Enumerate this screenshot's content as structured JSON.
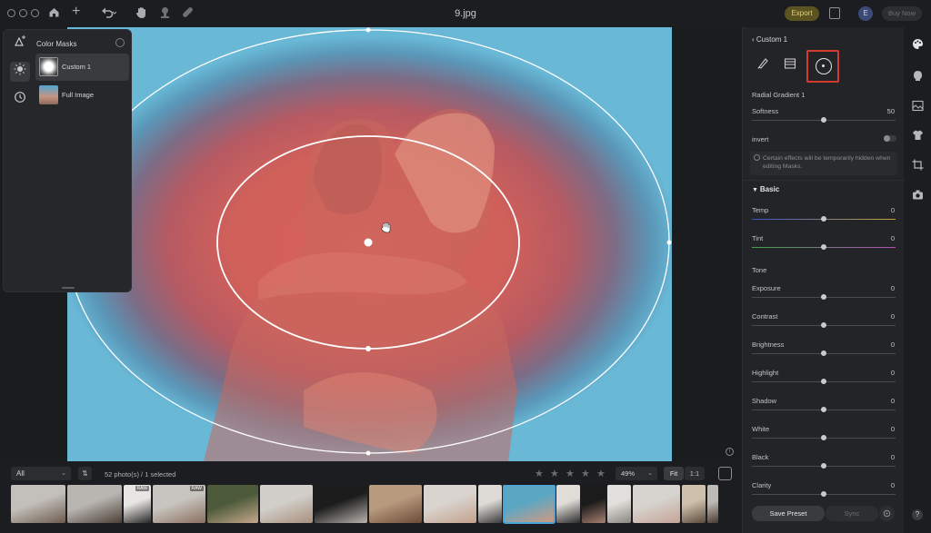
{
  "window": {
    "title": "9.jpg"
  },
  "toolbar": {
    "export_label": "Export",
    "avatar_initial": "E",
    "buy_now_label": "Buy Now"
  },
  "mask_panel": {
    "title": "Color Masks",
    "items": [
      {
        "label": "Custom 1",
        "selected": true
      },
      {
        "label": "Full Image",
        "selected": false
      }
    ]
  },
  "filmstrip_bar": {
    "filter_value": "All",
    "photo_count": "52 photo(s) / 1 selected",
    "rating_stars": 5,
    "zoom_value": "49%",
    "fit_label": "Fit",
    "one_to_one_label": "1:1"
  },
  "filmstrip": {
    "thumbnails": [
      {
        "badge": "",
        "colors": [
          "#c3c0bb",
          "#6d5b4d"
        ]
      },
      {
        "badge": "",
        "colors": [
          "#b9b6b2",
          "#4b3f35"
        ]
      },
      {
        "badge": "RAW",
        "colors": [
          "#e8e6e2",
          "#262626"
        ]
      },
      {
        "badge": "RAW",
        "colors": [
          "#c8c5c0",
          "#8b6f5e"
        ]
      },
      {
        "badge": "",
        "colors": [
          "#4c5a3a",
          "#c7a88c"
        ]
      },
      {
        "badge": "",
        "colors": [
          "#d2cfca",
          "#a88f7c"
        ]
      },
      {
        "badge": "",
        "colors": [
          "#1c1c1c",
          "#b9b3ae"
        ]
      },
      {
        "badge": "",
        "colors": [
          "#b89a7e",
          "#6b4a36"
        ]
      },
      {
        "badge": "",
        "colors": [
          "#d9d4cf",
          "#c3a08a"
        ]
      },
      {
        "badge": "",
        "colors": [
          "#dedbd6",
          "#3a3a3a"
        ]
      },
      {
        "badge": "",
        "colors": [
          "#5aa7c4",
          "#d49a80"
        ]
      },
      {
        "badge": "",
        "colors": [
          "#e0ddd8",
          "#2a2a2a"
        ]
      },
      {
        "badge": "",
        "colors": [
          "#1b1b1b",
          "#a88070"
        ]
      },
      {
        "badge": "",
        "colors": [
          "#e2e0dc",
          "#8a8580"
        ]
      },
      {
        "badge": "",
        "colors": [
          "#d7d3cf",
          "#c5a394"
        ]
      },
      {
        "badge": "",
        "colors": [
          "#cfc0ae",
          "#5a4a3a"
        ]
      },
      {
        "badge": "",
        "colors": [
          "#bdb9b4",
          "#4a3a30"
        ]
      }
    ]
  },
  "right_panel": {
    "back_label": "Custom 1",
    "mask_tools": [
      {
        "icon": "brush-icon"
      },
      {
        "icon": "linear-gradient-icon"
      },
      {
        "icon": "radial-gradient-icon",
        "selected": true
      }
    ],
    "radial_section_title": "Radial Gradient 1",
    "softness": {
      "label": "Softness",
      "value": "50",
      "fraction": 0.5
    },
    "invert": {
      "label": "invert",
      "on": false
    },
    "notice": "Certain effects will be temporarily hidden when editing Masks.",
    "basic_heading": "Basic",
    "tone_heading": "Tone",
    "sliders_top": [
      {
        "label": "Temp",
        "value": "0",
        "fraction": 0.5
      },
      {
        "label": "Tint",
        "value": "0",
        "fraction": 0.5
      }
    ],
    "sliders_tone": [
      {
        "label": "Exposure",
        "value": "0",
        "fraction": 0.5
      },
      {
        "label": "Contrast",
        "value": "0",
        "fraction": 0.5
      },
      {
        "label": "Brightness",
        "value": "0",
        "fraction": 0.5
      },
      {
        "label": "Highlight",
        "value": "0",
        "fraction": 0.5
      },
      {
        "label": "Shadow",
        "value": "0",
        "fraction": 0.5
      },
      {
        "label": "White",
        "value": "0",
        "fraction": 0.5
      },
      {
        "label": "Black",
        "value": "0",
        "fraction": 0.5
      },
      {
        "label": "Clarity",
        "value": "0",
        "fraction": 0.5
      }
    ],
    "save_preset_label": "Save Preset",
    "sync_label": "Sync"
  },
  "side_toolbar": {
    "icons": [
      "palette-icon",
      "face-icon",
      "background-icon",
      "clothing-icon",
      "crop-icon",
      "camera-icon"
    ]
  },
  "colors": {
    "accent_highlight": "#d43b2e",
    "selection_outline": "#4ba3d8",
    "mask_overlay": "#d8625a"
  }
}
